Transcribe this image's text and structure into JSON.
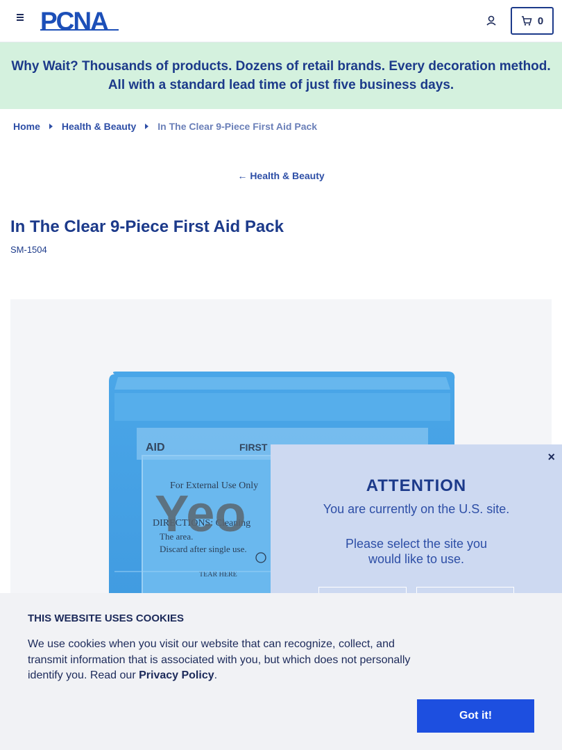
{
  "header": {
    "logo_text": "PCNA",
    "cart_count": "0",
    "icons": {
      "menu": "hamburger-menu-icon",
      "account": "user-icon",
      "cart": "cart-icon"
    }
  },
  "promo": {
    "lead": "Why Wait?",
    "text": "Thousands of products. Dozens of retail brands. Every decoration method. All with a standard lead time of just five business days."
  },
  "breadcrumb": {
    "home": "Home",
    "category": "Health & Beauty",
    "current": "In The Clear 9-Piece First Aid Pack"
  },
  "back_link": {
    "label": "Health & Beauty"
  },
  "product": {
    "title": "In The Clear 9-Piece First Aid Pack",
    "sku": "SM-1504",
    "image_text": {
      "aid_label": "AID",
      "first_label": "FIRST",
      "external": "For External Use Only",
      "directions": "DIRECTIONS: Cleaning",
      "the_area": "The area.",
      "discard": "Discard after single use.",
      "tear": "TEAR HERE",
      "brand": "Yeo"
    }
  },
  "attention": {
    "title": "ATTENTION",
    "line1": "You are currently on the U.S. site.",
    "line2": "Please select the site you would like to use.",
    "close": "×"
  },
  "cookie": {
    "title": "THIS WEBSITE USES COOKIES",
    "text": "We use cookies when you visit our website that can recognize, collect, and transmit information that is associated with you, but which does not personally identify you. Read our ",
    "link": "Privacy Policy",
    "period": ".",
    "button": "Got it!"
  },
  "colors": {
    "brand": "#1c3a8a",
    "promo_bg": "#d4f1de",
    "cta": "#1d4fe0",
    "modal_bg": "#cdd9f1"
  }
}
